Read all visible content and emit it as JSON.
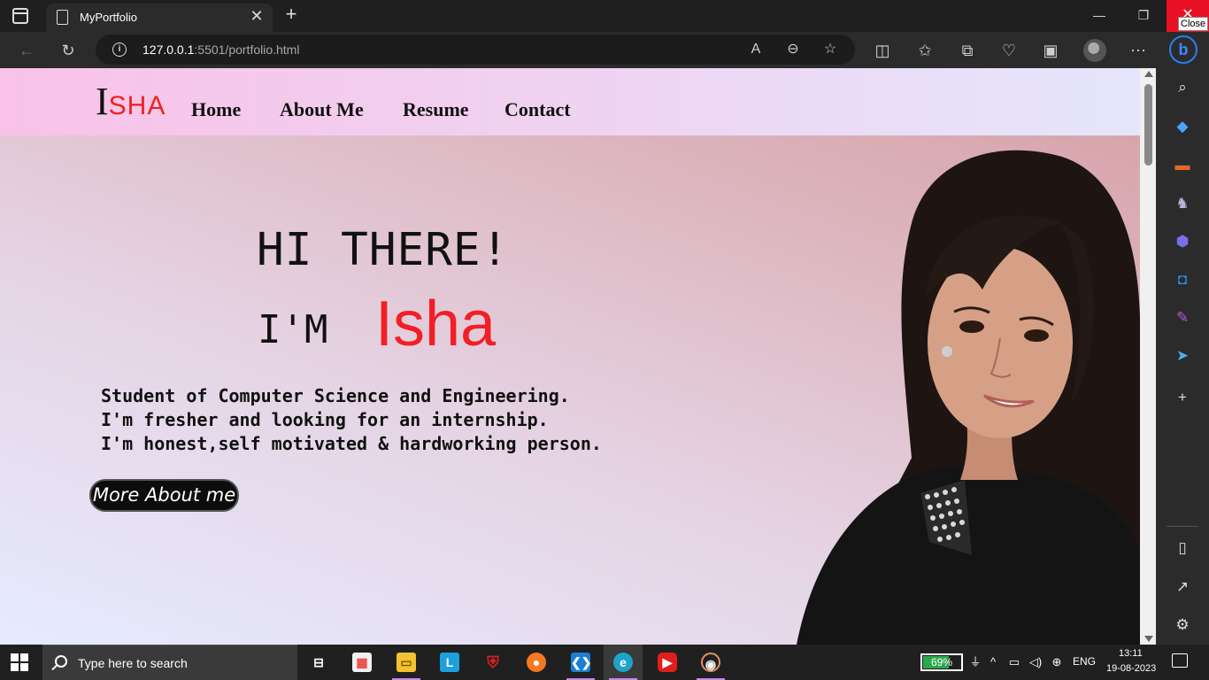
{
  "browser": {
    "tab_title": "MyPortfolio",
    "new_tab_glyph": "+",
    "tab_close_glyph": "✕",
    "url_host": "127.0.0.1",
    "url_rest": ":5501/portfolio.html",
    "tooltip_close": "Close",
    "icons": [
      "tab-actions-icon",
      "page-icon",
      "back-arrow-icon",
      "refresh-icon",
      "info-icon",
      "read-aloud-icon",
      "zoom-out-icon",
      "favorite-star-icon",
      "split-screen-icon",
      "favorites-icon",
      "collections-icon",
      "browser-essentials-icon",
      "web-capture-icon",
      "profile-avatar",
      "more-options-icon",
      "bing-copilot-icon"
    ]
  },
  "sidebar": {
    "icons": [
      "search-icon",
      "shopping-tag-icon",
      "tools-icon",
      "games-icon",
      "copilot-icon",
      "outlook-icon",
      "designer-icon",
      "send-icon",
      "add-icon",
      "sidebar-toggle-icon",
      "external-link-icon",
      "settings-icon"
    ]
  },
  "site": {
    "logo_initial": "I",
    "logo_rest": "SHA",
    "nav": [
      "Home",
      "About Me",
      "Resume",
      "Contact"
    ],
    "hero": {
      "greeting": "HI THERE!",
      "im": "I'M",
      "name": "Isha",
      "lines": [
        "Student of Computer Science and Engineering.",
        "I'm fresher and looking for an internship.",
        "I'm honest,self motivated & hardworking person."
      ],
      "button": "More About me"
    },
    "colors": {
      "accent_red": "#f21f26",
      "nav_pink": "#f9c2e8"
    }
  },
  "taskbar": {
    "search_placeholder": "Type here to search",
    "battery": "69%",
    "language": "ENG",
    "time": "13:11",
    "date": "19-08-2023",
    "apps": [
      "task-view",
      "microsoft-store",
      "file-explorer",
      "l-app",
      "mcafee",
      "firefox",
      "vs-code",
      "edge",
      "youtube",
      "media-player"
    ]
  }
}
